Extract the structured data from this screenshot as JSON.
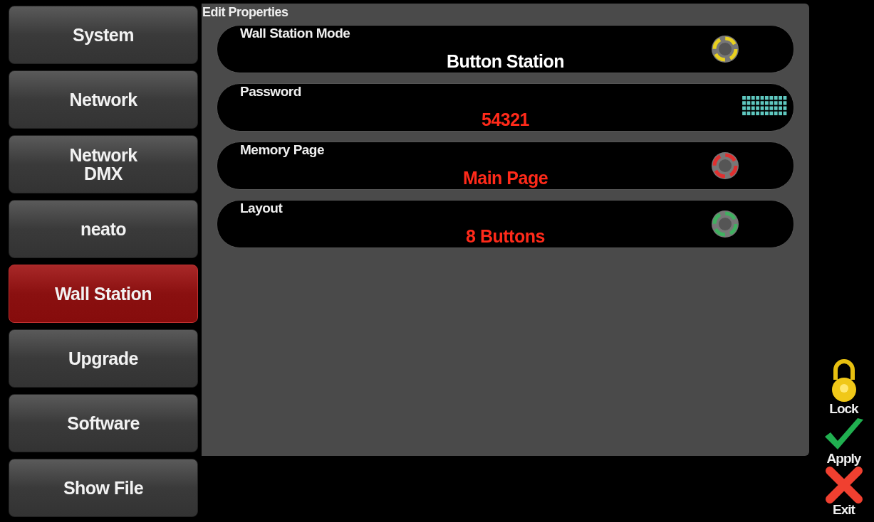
{
  "sidebar": {
    "items": [
      {
        "label": "System",
        "selected": false
      },
      {
        "label": "Network",
        "selected": false
      },
      {
        "label": "Network\nDMX",
        "selected": false
      },
      {
        "label": "neato",
        "selected": false
      },
      {
        "label": "Wall Station",
        "selected": true
      },
      {
        "label": "Upgrade",
        "selected": false
      },
      {
        "label": "Software",
        "selected": false
      },
      {
        "label": "Show File",
        "selected": false
      }
    ]
  },
  "panel": {
    "title": "Edit Properties",
    "properties": [
      {
        "label": "Wall Station Mode",
        "value": {
          "text": "Button Station",
          "color": "#ffffff"
        },
        "icon": {
          "kind": "dial",
          "color": "#e8d020"
        }
      },
      {
        "label": "Password",
        "value": {
          "text": "54321",
          "color": "#ff2a1a"
        },
        "icon": {
          "kind": "keypad",
          "color": "#5fc8c0"
        }
      },
      {
        "label": "Memory Page",
        "value": {
          "text": "Main Page",
          "color": "#ff2a1a"
        },
        "icon": {
          "kind": "dial",
          "color": "#e03030"
        }
      },
      {
        "label": "Layout",
        "value": {
          "text": "8 Buttons",
          "color": "#ff2a1a"
        },
        "icon": {
          "kind": "dial",
          "color": "#40b060"
        }
      }
    ]
  },
  "actions": [
    {
      "label": "Lock",
      "kind": "lock"
    },
    {
      "label": "Apply",
      "kind": "apply"
    },
    {
      "label": "Exit",
      "kind": "exit"
    }
  ]
}
